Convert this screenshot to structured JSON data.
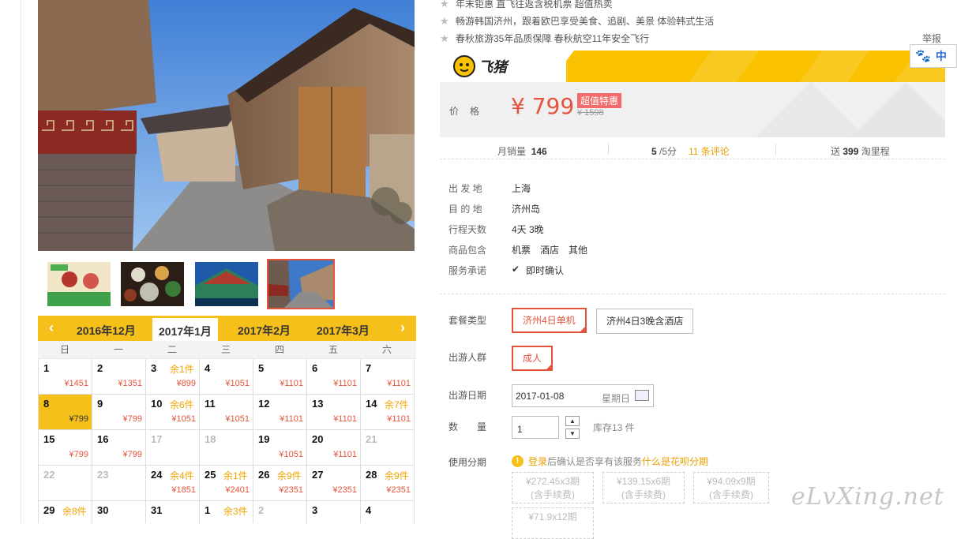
{
  "bullets": [
    "年末钜惠 直飞往返含税机票 超值热卖",
    "畅游韩国济州，跟着欧巴享受美食、追剧、美景 体验韩式生活",
    "春秋旅游35年品质保障 春秋航空11年安全飞行"
  ],
  "report": "举报",
  "brand": {
    "name": "飞猪"
  },
  "price": {
    "label": "价格",
    "value": "¥ 799",
    "badge": "超值特惠",
    "original": "¥ 1598"
  },
  "stats": {
    "monthly_label": "月销量",
    "monthly_value": "146",
    "rating": "5",
    "rating_suffix": "/5分",
    "reviews": "11 条评论",
    "miles_prefix": "送",
    "miles_value": "399",
    "miles_suffix": "淘里程"
  },
  "info": [
    {
      "k": "出 发 地",
      "v": "上海"
    },
    {
      "k": "目 的 地",
      "v": "济州岛"
    },
    {
      "k": "行程天数",
      "v": "4天 3晚"
    },
    {
      "k": "商品包含",
      "v": "机票　酒店　其他"
    },
    {
      "k": "服务承诺",
      "v": "即时确认"
    }
  ],
  "package": {
    "label": "套餐类型",
    "options": [
      "济州4日单机",
      "济州4日3晚含酒店"
    ]
  },
  "group": {
    "label": "出游人群",
    "options": [
      "成人"
    ]
  },
  "date": {
    "label": "出游日期",
    "value": "2017-01-08",
    "weekday": "星期日"
  },
  "quantity": {
    "label": "数　　量",
    "value": "1",
    "stock": "库存13 件"
  },
  "installment": {
    "label": "使用分期",
    "note_link": "登录",
    "note_text": "后确认是否享有该服务",
    "note_link2": "什么是花呗分期",
    "plans": [
      {
        "l1": "¥272.45x3期",
        "l2": "(含手续费)"
      },
      {
        "l1": "¥139.15x6期",
        "l2": "(含手续费)"
      },
      {
        "l1": "¥94.09x9期",
        "l2": "(含手续费)"
      },
      {
        "l1": "¥71.9x12期",
        "l2": ""
      }
    ]
  },
  "paywidget": {
    "text": "中"
  },
  "calendar": {
    "prev": "‹",
    "next": "›",
    "months": [
      "2016年12月",
      "2017年1月",
      "2017年2月",
      "2017年3月"
    ],
    "current": "2017年1月",
    "weekdays": [
      "日",
      "一",
      "二",
      "三",
      "四",
      "五",
      "六"
    ],
    "days": [
      {
        "d": "1",
        "p": "¥1451",
        "r": ""
      },
      {
        "d": "2",
        "p": "¥1351",
        "r": ""
      },
      {
        "d": "3",
        "p": "¥899",
        "r": "余1件"
      },
      {
        "d": "4",
        "p": "¥1051",
        "r": ""
      },
      {
        "d": "5",
        "p": "¥1101",
        "r": ""
      },
      {
        "d": "6",
        "p": "¥1101",
        "r": ""
      },
      {
        "d": "7",
        "p": "¥1101",
        "r": ""
      },
      {
        "d": "8",
        "p": "¥799",
        "r": "",
        "sel": true
      },
      {
        "d": "9",
        "p": "¥799",
        "r": ""
      },
      {
        "d": "10",
        "p": "¥1051",
        "r": "余6件"
      },
      {
        "d": "11",
        "p": "¥1051",
        "r": ""
      },
      {
        "d": "12",
        "p": "¥1101",
        "r": ""
      },
      {
        "d": "13",
        "p": "¥1101",
        "r": ""
      },
      {
        "d": "14",
        "p": "¥1101",
        "r": "余7件"
      },
      {
        "d": "15",
        "p": "¥799",
        "r": ""
      },
      {
        "d": "16",
        "p": "¥799",
        "r": ""
      },
      {
        "d": "17",
        "p": "",
        "r": "",
        "gray": true
      },
      {
        "d": "18",
        "p": "",
        "r": "",
        "gray": true
      },
      {
        "d": "19",
        "p": "¥1051",
        "r": ""
      },
      {
        "d": "20",
        "p": "¥1101",
        "r": ""
      },
      {
        "d": "21",
        "p": "",
        "r": "",
        "gray": true
      },
      {
        "d": "22",
        "p": "",
        "r": "",
        "gray": true
      },
      {
        "d": "23",
        "p": "",
        "r": "",
        "gray": true
      },
      {
        "d": "24",
        "p": "¥1851",
        "r": "余4件"
      },
      {
        "d": "25",
        "p": "¥2401",
        "r": "余1件"
      },
      {
        "d": "26",
        "p": "¥2351",
        "r": "余9件"
      },
      {
        "d": "27",
        "p": "¥2351",
        "r": ""
      },
      {
        "d": "28",
        "p": "¥2351",
        "r": "余9件"
      },
      {
        "d": "29",
        "p": "",
        "r": "余8件"
      },
      {
        "d": "30",
        "p": "",
        "r": ""
      },
      {
        "d": "31",
        "p": "",
        "r": ""
      },
      {
        "d": "1",
        "p": "",
        "r": "余3件"
      },
      {
        "d": "2",
        "p": "",
        "r": "",
        "gray": true
      },
      {
        "d": "3",
        "p": "",
        "r": ""
      },
      {
        "d": "4",
        "p": "",
        "r": ""
      }
    ]
  },
  "watermark": "eLvXing.net"
}
